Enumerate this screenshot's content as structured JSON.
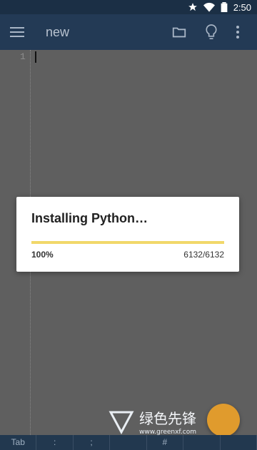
{
  "status_bar": {
    "time": "2:50",
    "icons": [
      "star-icon",
      "wifi-icon",
      "battery-icon"
    ]
  },
  "app_bar": {
    "title": "new",
    "icons": [
      "menu-icon",
      "folder-icon",
      "lightbulb-icon",
      "more-vert-icon"
    ]
  },
  "editor": {
    "line_numbers": [
      "1"
    ]
  },
  "dialog": {
    "title": "Installing Python…",
    "progress_percent": "100%",
    "progress_count": "6132/6132",
    "progress_fraction": 1.0
  },
  "bottom_bar": {
    "keys": [
      "Tab",
      ":",
      ";",
      "",
      "#",
      "",
      ""
    ]
  },
  "watermark": {
    "text": "绿色先锋",
    "url": "www.greenxf.com"
  },
  "colors": {
    "status_bar": "#1b2f45",
    "app_bar": "#233a55",
    "editor_dim": "#5f5f5f",
    "progress_fill": "#f1d86a",
    "fab": "#e09b2d"
  }
}
